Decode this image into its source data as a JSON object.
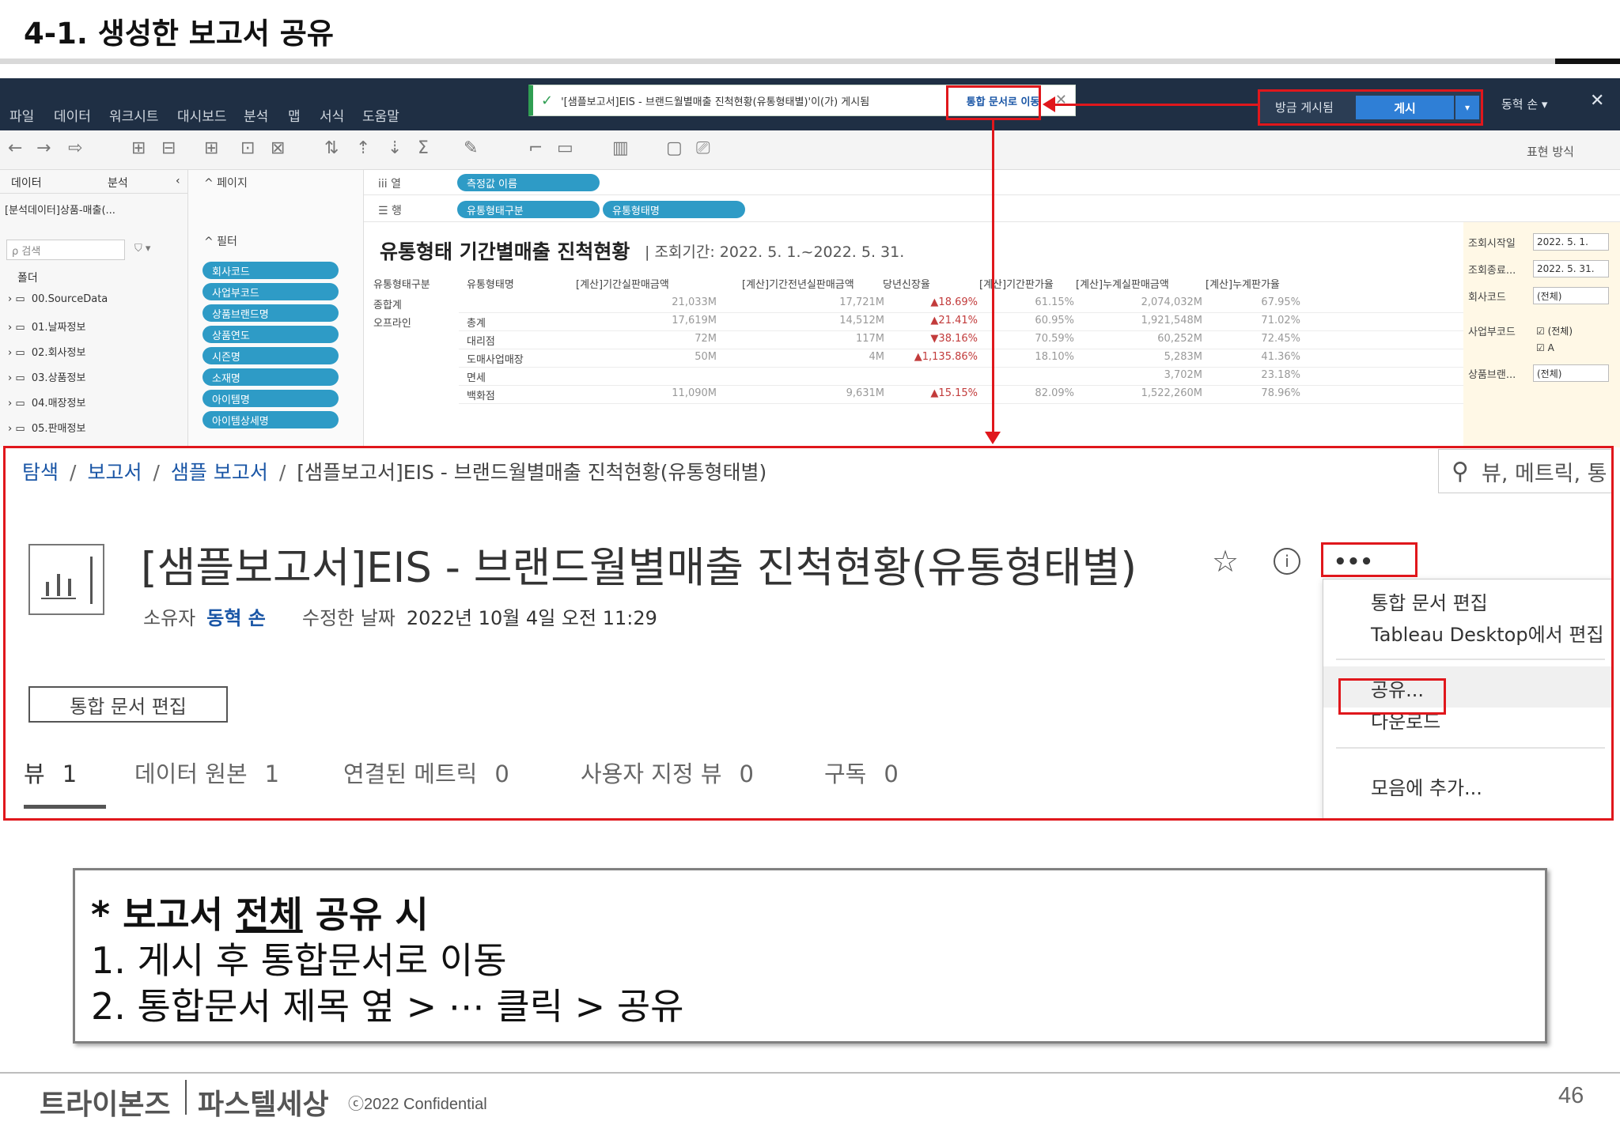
{
  "slide": {
    "title": "4-1. 생성한 보고서 공유",
    "page_number": "46",
    "copyright": "ⓒ2022 Confidential",
    "logo_primary": "트라이본즈",
    "logo_secondary": "파스텔세상"
  },
  "desktop": {
    "menu": [
      "파일",
      "데이터",
      "워크시트",
      "대시보드",
      "분석",
      "맵",
      "서식",
      "도움말"
    ],
    "notification": {
      "check_icon": "check-icon",
      "message": "'[샘플보고서]EIS - 브랜드월별매출 진척현황(유통형태별)'이(가) 게시됨",
      "goto": "통합 문서로 이동",
      "close": "✕"
    },
    "publish": {
      "label": "방금 게시됨",
      "button": "게시",
      "dropdown": "▾"
    },
    "user": "동혁 손 ▾",
    "close": "✕",
    "show_me": "표현 방식",
    "left_tabs": [
      "데이터",
      "분석",
      "‹"
    ],
    "data_source": "[분석데이터]상품-매출(...",
    "search_placeholder": "ρ 검색",
    "filter_icon": "⛉ ▾",
    "folder": "폴더",
    "tree": [
      "00.SourceData",
      "01.날짜정보",
      "02.회사정보",
      "03.상품정보",
      "04.매장정보",
      "05.판매정보"
    ],
    "pages_label": "^ 페이지",
    "filters_label": "^ 필터",
    "filter_pills": [
      "회사코드",
      "사업부코드",
      "상품브랜드명",
      "상품연도",
      "시즌명",
      "소재명",
      "아이템명",
      "아이템상세명"
    ],
    "shelves": {
      "columns_label": "iii 열",
      "rows_label": "☰ 행",
      "column_pills": [
        "측정값 이름"
      ],
      "row_pills": [
        "유통형태구분",
        "유통형태명"
      ]
    },
    "viz_title": "유통형태 기간별매출 진척현황",
    "viz_period": "| 조회기간: 2022. 5. 1.~2022. 5. 31.",
    "table": {
      "headers": [
        "유통형태구분",
        "유통형태명",
        "[계산]기간실판매금액",
        "[계산]기간전년실판매금액",
        "당년신장율",
        "[계산]기간판가율",
        "[계산]누계실판매금액",
        "[계산]누계판가율"
      ],
      "rows": [
        [
          "종합계",
          "",
          "21,033M",
          "17,721M",
          "▲18.69%",
          "61.15%",
          "2,074,032M",
          "67.95%"
        ],
        [
          "오프라인",
          "총계",
          "17,619M",
          "14,512M",
          "▲21.41%",
          "60.95%",
          "1,921,548M",
          "71.02%"
        ],
        [
          "",
          "대리점",
          "72M",
          "117M",
          "▼38.16%",
          "70.59%",
          "60,252M",
          "72.45%"
        ],
        [
          "",
          "도매사업매장",
          "50M",
          "4M",
          "▲1,135.86%",
          "18.10%",
          "5,283M",
          "41.36%"
        ],
        [
          "",
          "면세",
          "",
          "",
          "",
          "",
          "3,702M",
          "23.18%"
        ],
        [
          "",
          "백화점",
          "11,090M",
          "9,631M",
          "▲15.15%",
          "82.09%",
          "1,522,260M",
          "78.96%"
        ]
      ]
    },
    "params": [
      {
        "label": "조회시작일",
        "value": "2022. 5. 1."
      },
      {
        "label": "조회종료...",
        "value": "2022. 5. 31."
      },
      {
        "label": "회사코드",
        "value": "(전체)"
      },
      {
        "label": "사업부코드",
        "value": "☑ (전체)"
      },
      {
        "label": "",
        "value": "☑ A"
      },
      {
        "label": "상품브랜...",
        "value": "(전체)"
      }
    ]
  },
  "server": {
    "breadcrumb": [
      {
        "label": "탐색",
        "link": true
      },
      {
        "label": "보고서",
        "link": true
      },
      {
        "label": "샘플 보고서",
        "link": true
      },
      {
        "label": "[샘플보고서]EIS - 브랜드월별매출 진척현황(유통형태별)",
        "link": false
      }
    ],
    "search_placeholder": "뷰, 메트릭, 통",
    "workbook_title": "[샘플보고서]EIS - 브랜드월별매출 진척현황(유통형태별)",
    "owner_label": "소유자",
    "owner_name": "동혁 손",
    "modified_label": "수정한 날짜",
    "modified_value": "2022년 10월 4일 오전 11:29",
    "edit_button": "통합 문서 편집",
    "more_label": "•••",
    "star": "☆",
    "info": "i",
    "tabs": [
      {
        "label": "뷰",
        "count": "1"
      },
      {
        "label": "데이터 원본",
        "count": "1"
      },
      {
        "label": "연결된 메트릭",
        "count": "0"
      },
      {
        "label": "사용자 지정 뷰",
        "count": "0"
      },
      {
        "label": "구독",
        "count": "0"
      }
    ],
    "menu": [
      "통합 문서 편집",
      "Tableau Desktop에서 편집",
      "공유...",
      "다운로드",
      "모음에 추가..."
    ]
  },
  "note": {
    "heading_prefix": "* 보고서 ",
    "heading_emph": "전체",
    "heading_suffix": " 공유 시",
    "step1": "1.   게시 후 통합문서로 이동",
    "step2": "2.    통합문서 제목 옆 > ⋯ 클릭 > 공유"
  },
  "colors": {
    "annotation": "#e0171c",
    "tableau_header": "#1f2f44",
    "pill": "#2e9bc6",
    "link": "#1a56a6"
  }
}
